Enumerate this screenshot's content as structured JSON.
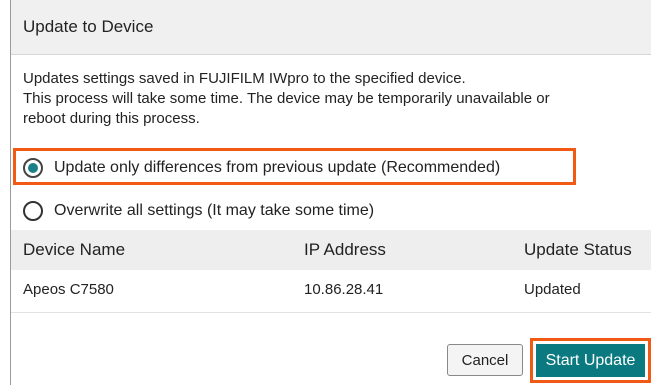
{
  "dialog": {
    "title": "Update to Device",
    "description_lines": [
      "Updates settings saved in FUJIFILM IWpro to the specified device.",
      "This process will take some time. The device may be temporarily unavailable or",
      "reboot during this process."
    ]
  },
  "options": [
    {
      "label": "Update only differences from previous update (Recommended)",
      "selected": true
    },
    {
      "label": "Overwrite all settings (It may take some time)",
      "selected": false
    }
  ],
  "table": {
    "columns": [
      "Device Name",
      "IP Address",
      "Update Status"
    ],
    "rows": [
      [
        "Apeos C7580",
        "10.86.28.41",
        "Updated"
      ]
    ]
  },
  "buttons": {
    "cancel_label": "Cancel",
    "start_label": "Start Update"
  },
  "colors": {
    "accent": "#0a7a80",
    "highlight": "#f05a14",
    "header_bg": "#f0f0f0"
  }
}
